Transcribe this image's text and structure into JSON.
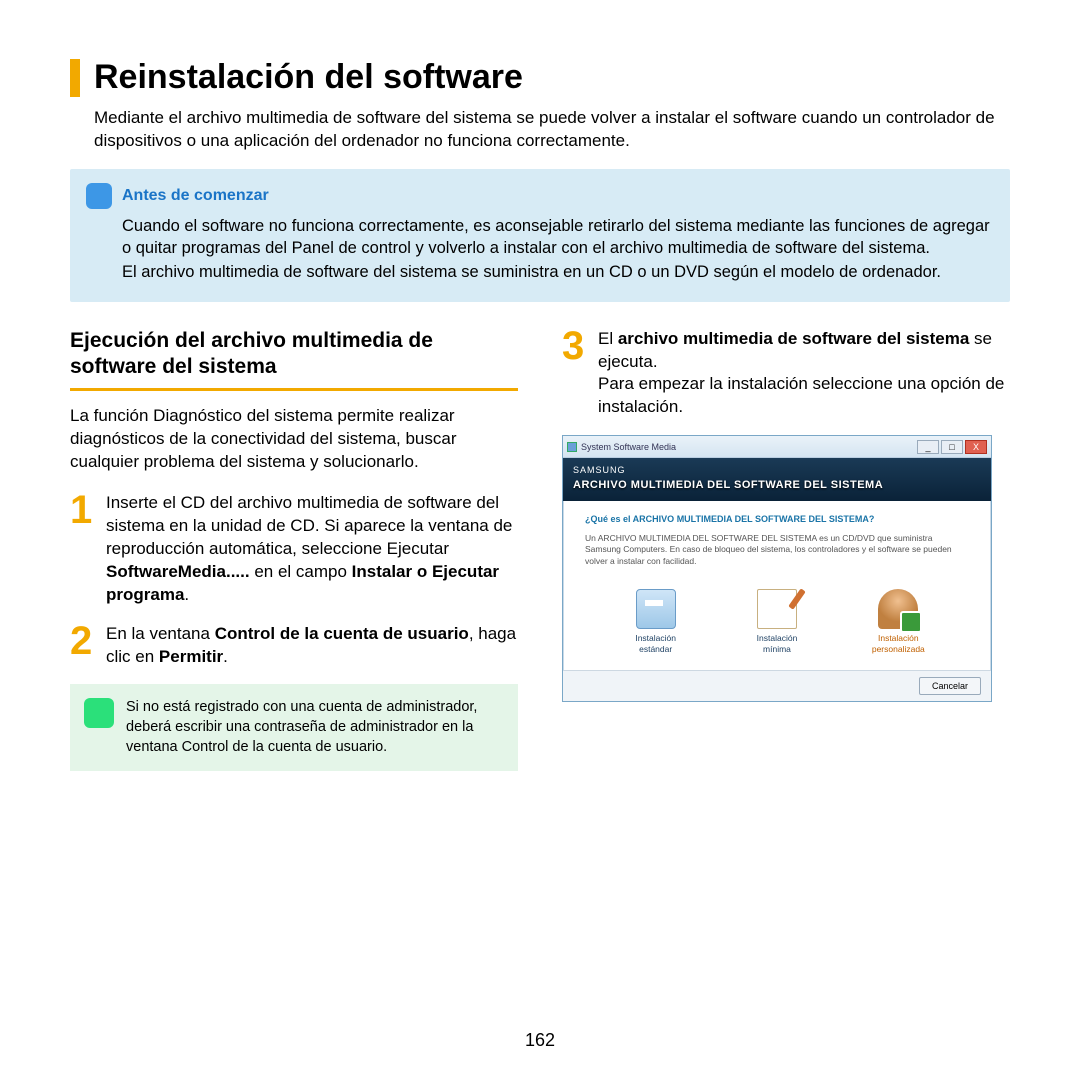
{
  "title": "Reinstalación del software",
  "intro": "Mediante el archivo multimedia de software del sistema se puede volver a instalar el software cuando un controlador de dispositivos o una aplicación del ordenador no funciona correctamente.",
  "callout": {
    "title": "Antes de comenzar",
    "p1": "Cuando el software no funciona correctamente, es aconsejable retirarlo del sistema mediante las funciones de agregar o quitar programas del Panel de control y volverlo a instalar con el archivo multimedia de software del sistema.",
    "p2": "El archivo multimedia de software del sistema se suministra en un CD o un DVD según el modelo de ordenador."
  },
  "left": {
    "heading": "Ejecución del archivo multimedia de software del sistema",
    "para": "La función Diagnóstico del sistema permite realizar diagnósticos de la conectividad del sistema, buscar cualquier problema del sistema y solucionarlo.",
    "step1_a": "Inserte el CD del archivo multimedia de software del sistema en la unidad de CD. Si aparece la ventana de reproducción automática, seleccione Ejecutar ",
    "step1_b1": "SoftwareMedia.....",
    "step1_c": " en el campo ",
    "step1_b2": "Instalar o Ejecutar programa",
    "step1_d": ".",
    "step2_a": "En la ventana ",
    "step2_b1": "Control de la cuenta de usuario",
    "step2_c": ", haga clic en ",
    "step2_b2": "Permitir",
    "step2_d": ".",
    "note": "Si no está registrado con una cuenta de administrador, deberá escribir una contraseña de administrador en la ventana Control de la cuenta de usuario."
  },
  "right": {
    "step3_a": "El ",
    "step3_b": "archivo multimedia de software del sistema",
    "step3_c": " se ejecuta.",
    "step3_p2": "Para empezar la instalación seleccione una opción de instalación."
  },
  "win": {
    "titlebar": "System Software Media",
    "brand": "SAMSUNG",
    "banner": "ARCHIVO MULTIMEDIA DEL SOFTWARE DEL SISTEMA",
    "question": "¿Qué es el ARCHIVO MULTIMEDIA DEL SOFTWARE DEL SISTEMA?",
    "desc": "Un ARCHIVO MULTIMEDIA DEL SOFTWARE DEL SISTEMA es un CD/DVD que suministra Samsung Computers. En caso de bloqueo del sistema, los controladores y el software se pueden volver a instalar con facilidad.",
    "opt1a": "Instalación",
    "opt1b": "estándar",
    "opt2a": "Instalación",
    "opt2b": "mínima",
    "opt3a": "Instalación",
    "opt3b": "personalizada",
    "cancel": "Cancelar",
    "min_btn": "_",
    "max_btn": "□",
    "close_btn": "X"
  },
  "page": "162"
}
